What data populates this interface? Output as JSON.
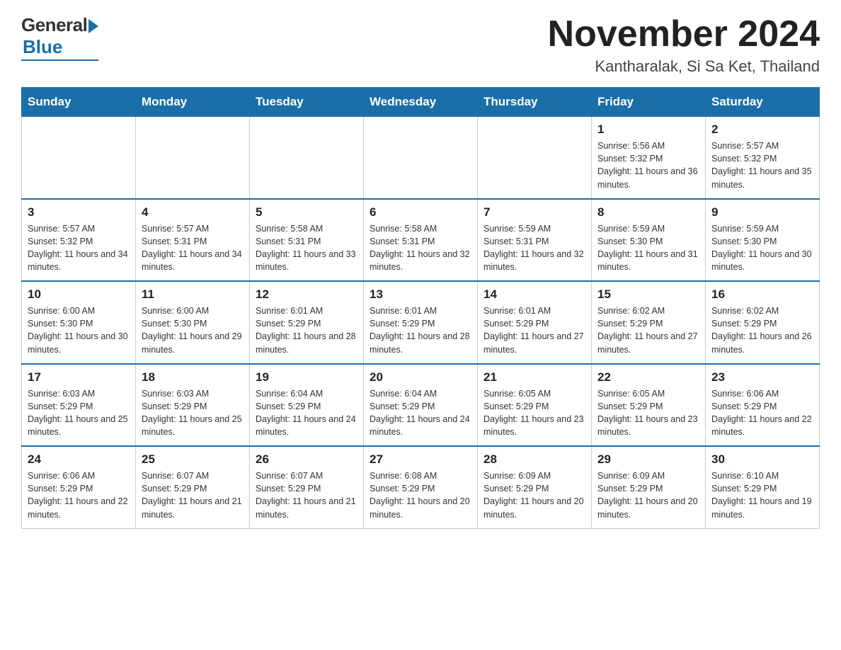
{
  "header": {
    "logo": {
      "general": "General",
      "blue": "Blue"
    },
    "title": "November 2024",
    "subtitle": "Kantharalak, Si Sa Ket, Thailand"
  },
  "calendar": {
    "days_of_week": [
      "Sunday",
      "Monday",
      "Tuesday",
      "Wednesday",
      "Thursday",
      "Friday",
      "Saturday"
    ],
    "weeks": [
      [
        {
          "day": "",
          "info": ""
        },
        {
          "day": "",
          "info": ""
        },
        {
          "day": "",
          "info": ""
        },
        {
          "day": "",
          "info": ""
        },
        {
          "day": "",
          "info": ""
        },
        {
          "day": "1",
          "info": "Sunrise: 5:56 AM\nSunset: 5:32 PM\nDaylight: 11 hours and 36 minutes."
        },
        {
          "day": "2",
          "info": "Sunrise: 5:57 AM\nSunset: 5:32 PM\nDaylight: 11 hours and 35 minutes."
        }
      ],
      [
        {
          "day": "3",
          "info": "Sunrise: 5:57 AM\nSunset: 5:32 PM\nDaylight: 11 hours and 34 minutes."
        },
        {
          "day": "4",
          "info": "Sunrise: 5:57 AM\nSunset: 5:31 PM\nDaylight: 11 hours and 34 minutes."
        },
        {
          "day": "5",
          "info": "Sunrise: 5:58 AM\nSunset: 5:31 PM\nDaylight: 11 hours and 33 minutes."
        },
        {
          "day": "6",
          "info": "Sunrise: 5:58 AM\nSunset: 5:31 PM\nDaylight: 11 hours and 32 minutes."
        },
        {
          "day": "7",
          "info": "Sunrise: 5:59 AM\nSunset: 5:31 PM\nDaylight: 11 hours and 32 minutes."
        },
        {
          "day": "8",
          "info": "Sunrise: 5:59 AM\nSunset: 5:30 PM\nDaylight: 11 hours and 31 minutes."
        },
        {
          "day": "9",
          "info": "Sunrise: 5:59 AM\nSunset: 5:30 PM\nDaylight: 11 hours and 30 minutes."
        }
      ],
      [
        {
          "day": "10",
          "info": "Sunrise: 6:00 AM\nSunset: 5:30 PM\nDaylight: 11 hours and 30 minutes."
        },
        {
          "day": "11",
          "info": "Sunrise: 6:00 AM\nSunset: 5:30 PM\nDaylight: 11 hours and 29 minutes."
        },
        {
          "day": "12",
          "info": "Sunrise: 6:01 AM\nSunset: 5:29 PM\nDaylight: 11 hours and 28 minutes."
        },
        {
          "day": "13",
          "info": "Sunrise: 6:01 AM\nSunset: 5:29 PM\nDaylight: 11 hours and 28 minutes."
        },
        {
          "day": "14",
          "info": "Sunrise: 6:01 AM\nSunset: 5:29 PM\nDaylight: 11 hours and 27 minutes."
        },
        {
          "day": "15",
          "info": "Sunrise: 6:02 AM\nSunset: 5:29 PM\nDaylight: 11 hours and 27 minutes."
        },
        {
          "day": "16",
          "info": "Sunrise: 6:02 AM\nSunset: 5:29 PM\nDaylight: 11 hours and 26 minutes."
        }
      ],
      [
        {
          "day": "17",
          "info": "Sunrise: 6:03 AM\nSunset: 5:29 PM\nDaylight: 11 hours and 25 minutes."
        },
        {
          "day": "18",
          "info": "Sunrise: 6:03 AM\nSunset: 5:29 PM\nDaylight: 11 hours and 25 minutes."
        },
        {
          "day": "19",
          "info": "Sunrise: 6:04 AM\nSunset: 5:29 PM\nDaylight: 11 hours and 24 minutes."
        },
        {
          "day": "20",
          "info": "Sunrise: 6:04 AM\nSunset: 5:29 PM\nDaylight: 11 hours and 24 minutes."
        },
        {
          "day": "21",
          "info": "Sunrise: 6:05 AM\nSunset: 5:29 PM\nDaylight: 11 hours and 23 minutes."
        },
        {
          "day": "22",
          "info": "Sunrise: 6:05 AM\nSunset: 5:29 PM\nDaylight: 11 hours and 23 minutes."
        },
        {
          "day": "23",
          "info": "Sunrise: 6:06 AM\nSunset: 5:29 PM\nDaylight: 11 hours and 22 minutes."
        }
      ],
      [
        {
          "day": "24",
          "info": "Sunrise: 6:06 AM\nSunset: 5:29 PM\nDaylight: 11 hours and 22 minutes."
        },
        {
          "day": "25",
          "info": "Sunrise: 6:07 AM\nSunset: 5:29 PM\nDaylight: 11 hours and 21 minutes."
        },
        {
          "day": "26",
          "info": "Sunrise: 6:07 AM\nSunset: 5:29 PM\nDaylight: 11 hours and 21 minutes."
        },
        {
          "day": "27",
          "info": "Sunrise: 6:08 AM\nSunset: 5:29 PM\nDaylight: 11 hours and 20 minutes."
        },
        {
          "day": "28",
          "info": "Sunrise: 6:09 AM\nSunset: 5:29 PM\nDaylight: 11 hours and 20 minutes."
        },
        {
          "day": "29",
          "info": "Sunrise: 6:09 AM\nSunset: 5:29 PM\nDaylight: 11 hours and 20 minutes."
        },
        {
          "day": "30",
          "info": "Sunrise: 6:10 AM\nSunset: 5:29 PM\nDaylight: 11 hours and 19 minutes."
        }
      ]
    ]
  }
}
